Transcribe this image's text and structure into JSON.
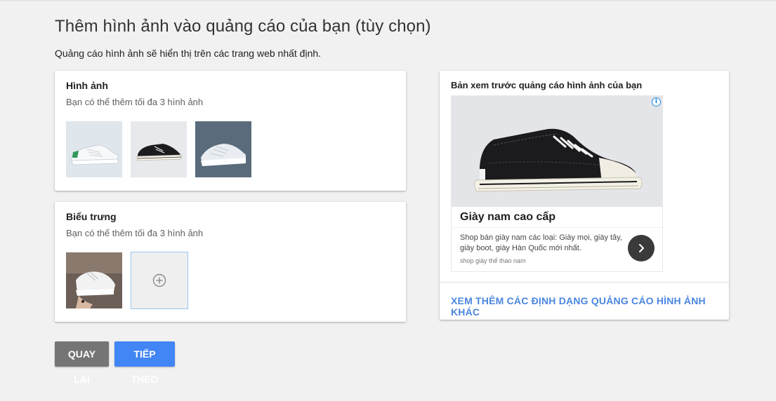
{
  "page": {
    "title": "Thêm hình ảnh vào quảng cáo của bạn (tùy chọn)",
    "subtitle": "Quảng cáo hình ảnh sẽ hiển thị trên các trang web nhất định."
  },
  "images_card": {
    "title": "Hình ảnh",
    "hint": "Bạn có thể thêm tối đa 3 hình ảnh"
  },
  "logos_card": {
    "title": "Biểu trưng",
    "hint": "Bạn có thể thêm tối đa 3 hình ảnh"
  },
  "preview": {
    "title": "Bản xem trước quảng cáo hình ảnh của bạn",
    "info_icon": "i",
    "ad_headline": "Giày nam cao cấp",
    "ad_description": "Shop bán giày nam các loại: Giày mọi, giày tây, giày boot, giày Hàn Quốc mới nhất.",
    "ad_source": "shop giày thể thao nam",
    "more_link": "XEM THÊM CÁC ĐỊNH DẠNG QUẢNG CÁO HÌNH ẢNH KHÁC"
  },
  "actions": {
    "back_label": "QUAY LẠI",
    "next_label": "TIẾP THEO"
  },
  "colors": {
    "background": "#f1f1f1",
    "primary": "#4285f4",
    "secondary_button": "#757575",
    "link": "#4a86e0",
    "add_tile_border": "#9dc3f0"
  },
  "icons": [
    "add-circle-icon",
    "info-icon",
    "chevron-right-icon"
  ]
}
